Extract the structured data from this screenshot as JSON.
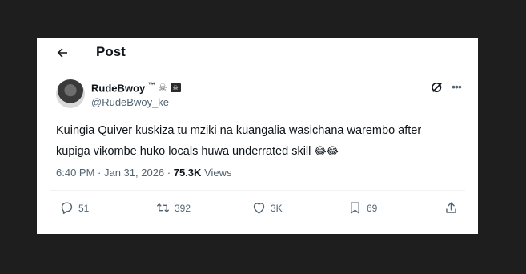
{
  "header": {
    "title": "Post"
  },
  "author": {
    "display_name": "RudeBwoy",
    "tm": "™",
    "badges": [
      "skull-crossbones-icon",
      "pirate-flag-icon"
    ],
    "handle": "@RudeBwoy_ke"
  },
  "post": {
    "text": "Kuingia Quiver kuskiza tu mziki na kuangalia wasichana warembo after kupiga vikombe huko locals huwa underrated skill",
    "emojis": "😂😂"
  },
  "meta": {
    "time": "6:40 PM",
    "separator": " · ",
    "date": "Jan 31, 2026",
    "views_count": "75.3K",
    "views_label": "Views"
  },
  "actions": {
    "replies": "51",
    "reposts": "392",
    "likes": "3K",
    "bookmarks": "69"
  },
  "colors": {
    "text_primary": "#0f1419",
    "text_secondary": "#536471",
    "card_background": "#ffffff",
    "page_background": "#1e1e1e"
  }
}
